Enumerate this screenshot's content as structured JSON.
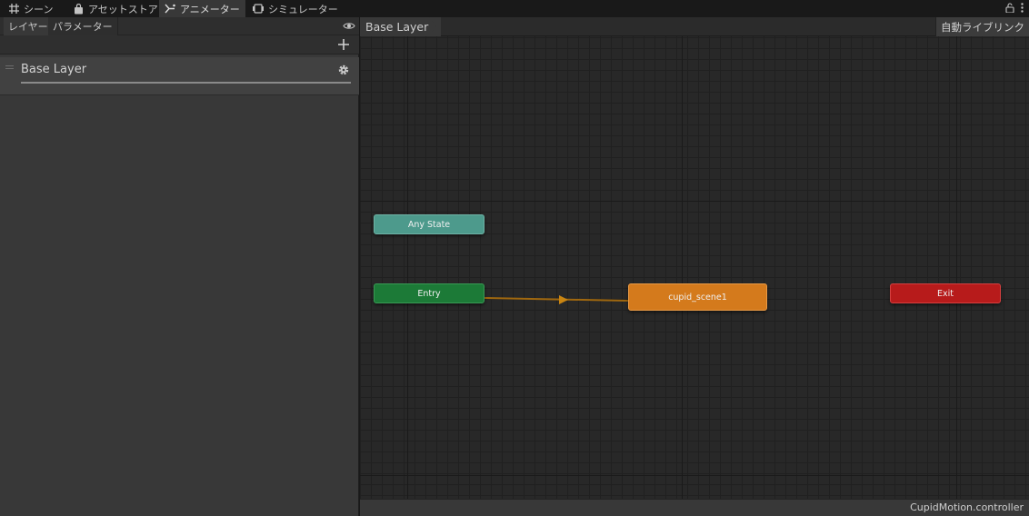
{
  "tabs": [
    {
      "label": "シーン",
      "icon": "grid-icon"
    },
    {
      "label": "アセットストア",
      "icon": "shopping-bag-icon"
    },
    {
      "label": "アニメーター",
      "icon": "animator-icon"
    },
    {
      "label": "シミュレーター",
      "icon": "simulator-icon"
    }
  ],
  "left_panel": {
    "subtabs": [
      "レイヤー",
      "パラメーター"
    ],
    "layer": {
      "name": "Base Layer"
    }
  },
  "graph": {
    "breadcrumb": "Base Layer",
    "auto_live_link": "自動ライブリンク",
    "nodes": {
      "any_state": "Any State",
      "entry": "Entry",
      "state": "cupid_scene1",
      "exit": "Exit"
    },
    "colors": {
      "any_state": "#4d9a8c",
      "entry": "#1c7a37",
      "state": "#d47a1c",
      "exit": "#b71b1b",
      "transition": "#a0680f"
    }
  },
  "status": {
    "file": "CupidMotion.controller"
  }
}
